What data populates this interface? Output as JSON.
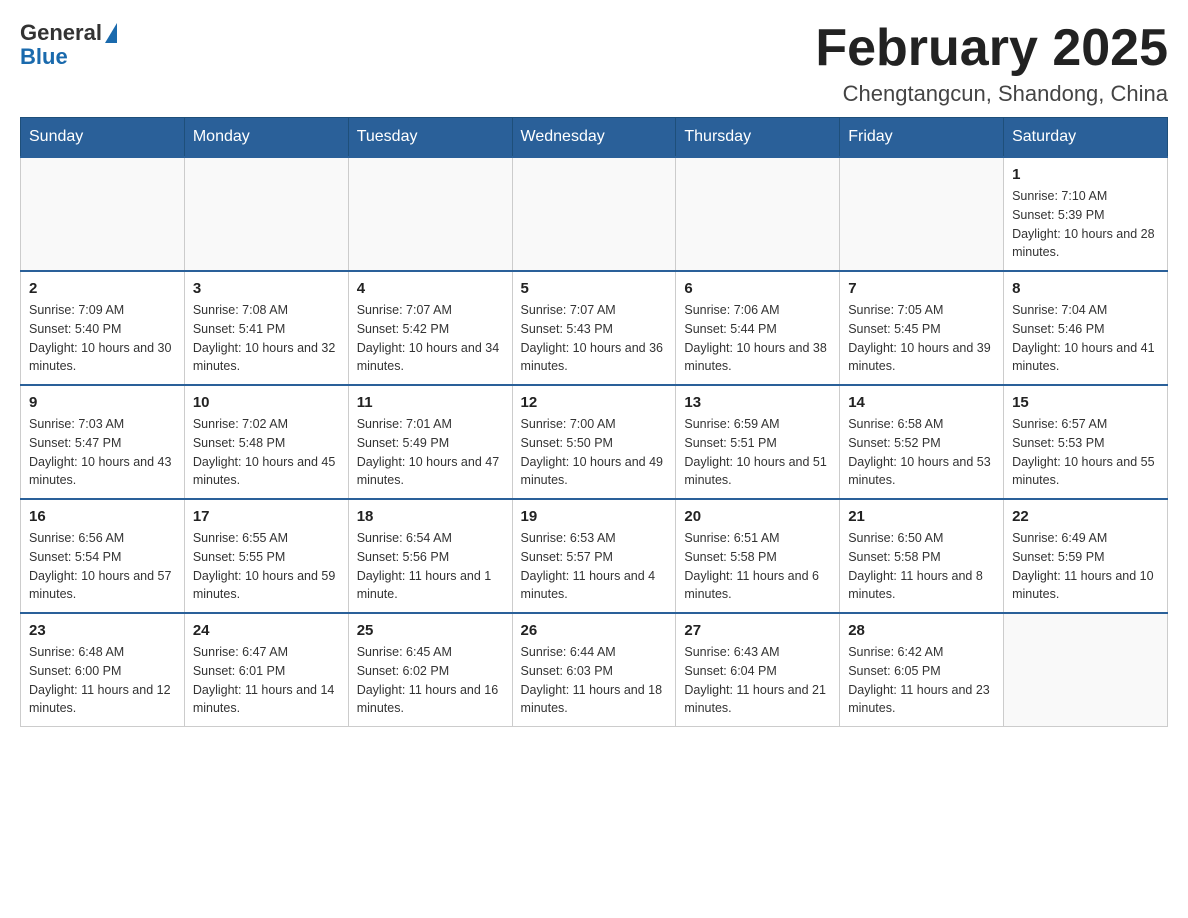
{
  "logo": {
    "general": "General",
    "blue": "Blue"
  },
  "header": {
    "month_year": "February 2025",
    "location": "Chengtangcun, Shandong, China"
  },
  "weekdays": [
    "Sunday",
    "Monday",
    "Tuesday",
    "Wednesday",
    "Thursday",
    "Friday",
    "Saturday"
  ],
  "weeks": [
    [
      {
        "day": "",
        "info": ""
      },
      {
        "day": "",
        "info": ""
      },
      {
        "day": "",
        "info": ""
      },
      {
        "day": "",
        "info": ""
      },
      {
        "day": "",
        "info": ""
      },
      {
        "day": "",
        "info": ""
      },
      {
        "day": "1",
        "info": "Sunrise: 7:10 AM\nSunset: 5:39 PM\nDaylight: 10 hours and 28 minutes."
      }
    ],
    [
      {
        "day": "2",
        "info": "Sunrise: 7:09 AM\nSunset: 5:40 PM\nDaylight: 10 hours and 30 minutes."
      },
      {
        "day": "3",
        "info": "Sunrise: 7:08 AM\nSunset: 5:41 PM\nDaylight: 10 hours and 32 minutes."
      },
      {
        "day": "4",
        "info": "Sunrise: 7:07 AM\nSunset: 5:42 PM\nDaylight: 10 hours and 34 minutes."
      },
      {
        "day": "5",
        "info": "Sunrise: 7:07 AM\nSunset: 5:43 PM\nDaylight: 10 hours and 36 minutes."
      },
      {
        "day": "6",
        "info": "Sunrise: 7:06 AM\nSunset: 5:44 PM\nDaylight: 10 hours and 38 minutes."
      },
      {
        "day": "7",
        "info": "Sunrise: 7:05 AM\nSunset: 5:45 PM\nDaylight: 10 hours and 39 minutes."
      },
      {
        "day": "8",
        "info": "Sunrise: 7:04 AM\nSunset: 5:46 PM\nDaylight: 10 hours and 41 minutes."
      }
    ],
    [
      {
        "day": "9",
        "info": "Sunrise: 7:03 AM\nSunset: 5:47 PM\nDaylight: 10 hours and 43 minutes."
      },
      {
        "day": "10",
        "info": "Sunrise: 7:02 AM\nSunset: 5:48 PM\nDaylight: 10 hours and 45 minutes."
      },
      {
        "day": "11",
        "info": "Sunrise: 7:01 AM\nSunset: 5:49 PM\nDaylight: 10 hours and 47 minutes."
      },
      {
        "day": "12",
        "info": "Sunrise: 7:00 AM\nSunset: 5:50 PM\nDaylight: 10 hours and 49 minutes."
      },
      {
        "day": "13",
        "info": "Sunrise: 6:59 AM\nSunset: 5:51 PM\nDaylight: 10 hours and 51 minutes."
      },
      {
        "day": "14",
        "info": "Sunrise: 6:58 AM\nSunset: 5:52 PM\nDaylight: 10 hours and 53 minutes."
      },
      {
        "day": "15",
        "info": "Sunrise: 6:57 AM\nSunset: 5:53 PM\nDaylight: 10 hours and 55 minutes."
      }
    ],
    [
      {
        "day": "16",
        "info": "Sunrise: 6:56 AM\nSunset: 5:54 PM\nDaylight: 10 hours and 57 minutes."
      },
      {
        "day": "17",
        "info": "Sunrise: 6:55 AM\nSunset: 5:55 PM\nDaylight: 10 hours and 59 minutes."
      },
      {
        "day": "18",
        "info": "Sunrise: 6:54 AM\nSunset: 5:56 PM\nDaylight: 11 hours and 1 minute."
      },
      {
        "day": "19",
        "info": "Sunrise: 6:53 AM\nSunset: 5:57 PM\nDaylight: 11 hours and 4 minutes."
      },
      {
        "day": "20",
        "info": "Sunrise: 6:51 AM\nSunset: 5:58 PM\nDaylight: 11 hours and 6 minutes."
      },
      {
        "day": "21",
        "info": "Sunrise: 6:50 AM\nSunset: 5:58 PM\nDaylight: 11 hours and 8 minutes."
      },
      {
        "day": "22",
        "info": "Sunrise: 6:49 AM\nSunset: 5:59 PM\nDaylight: 11 hours and 10 minutes."
      }
    ],
    [
      {
        "day": "23",
        "info": "Sunrise: 6:48 AM\nSunset: 6:00 PM\nDaylight: 11 hours and 12 minutes."
      },
      {
        "day": "24",
        "info": "Sunrise: 6:47 AM\nSunset: 6:01 PM\nDaylight: 11 hours and 14 minutes."
      },
      {
        "day": "25",
        "info": "Sunrise: 6:45 AM\nSunset: 6:02 PM\nDaylight: 11 hours and 16 minutes."
      },
      {
        "day": "26",
        "info": "Sunrise: 6:44 AM\nSunset: 6:03 PM\nDaylight: 11 hours and 18 minutes."
      },
      {
        "day": "27",
        "info": "Sunrise: 6:43 AM\nSunset: 6:04 PM\nDaylight: 11 hours and 21 minutes."
      },
      {
        "day": "28",
        "info": "Sunrise: 6:42 AM\nSunset: 6:05 PM\nDaylight: 11 hours and 23 minutes."
      },
      {
        "day": "",
        "info": ""
      }
    ]
  ]
}
